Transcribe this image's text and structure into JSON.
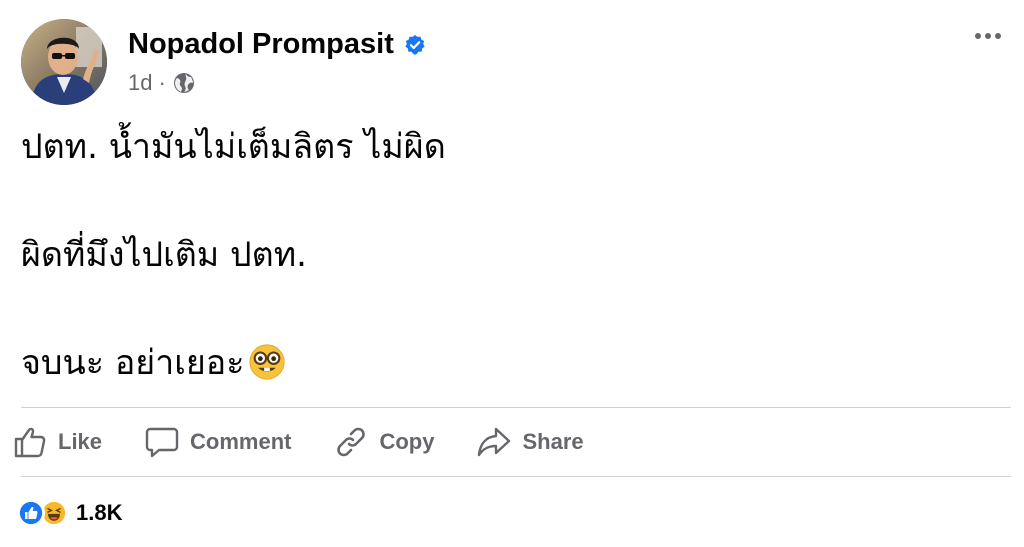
{
  "post": {
    "author": {
      "name": "Nopadol Prompasit",
      "verified": true
    },
    "time": "1d",
    "separator": "·",
    "audience_icon": "globe-icon",
    "lines": [
      "ปตท. น้ำมันไม่เต็มลิตร ไม่ผิด",
      "ผิดที่มึงไปเติม ปตท.",
      "จบนะ อย่าเยอะ"
    ],
    "trailing_emoji": "nerd-face-emoji"
  },
  "actions": {
    "like_label": "Like",
    "comment_label": "Comment",
    "copy_label": "Copy",
    "share_label": "Share"
  },
  "reactions": {
    "icons": [
      "like-reaction-icon",
      "haha-reaction-icon"
    ],
    "count": "1.8K"
  },
  "colors": {
    "text": "#050505",
    "secondary": "#65676b",
    "verified_blue": "#1877f2",
    "divider": "#ced0d4"
  }
}
